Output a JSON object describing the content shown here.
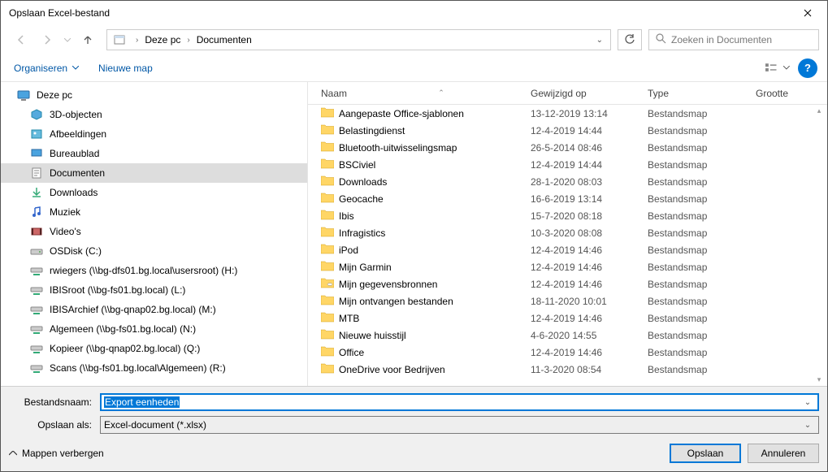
{
  "window": {
    "title": "Opslaan Excel-bestand"
  },
  "breadcrumb": {
    "root": "Deze pc",
    "folder": "Documenten"
  },
  "search": {
    "placeholder": "Zoeken in Documenten"
  },
  "toolbar": {
    "organize": "Organiseren",
    "newfolder": "Nieuwe map"
  },
  "columns": {
    "name": "Naam",
    "modified": "Gewijzigd op",
    "type": "Type",
    "size": "Grootte"
  },
  "tree": {
    "root": "Deze pc",
    "items": [
      {
        "label": "3D-objecten"
      },
      {
        "label": "Afbeeldingen"
      },
      {
        "label": "Bureaublad"
      },
      {
        "label": "Documenten",
        "selected": true
      },
      {
        "label": "Downloads"
      },
      {
        "label": "Muziek"
      },
      {
        "label": "Video's"
      },
      {
        "label": "OSDisk (C:)"
      },
      {
        "label": "rwiegers (\\\\bg-dfs01.bg.local\\usersroot) (H:)"
      },
      {
        "label": "IBISroot (\\\\bg-fs01.bg.local) (L:)"
      },
      {
        "label": "IBISArchief (\\\\bg-qnap02.bg.local) (M:)"
      },
      {
        "label": "Algemeen (\\\\bg-fs01.bg.local) (N:)"
      },
      {
        "label": "Kopieer (\\\\bg-qnap02.bg.local) (Q:)"
      },
      {
        "label": "Scans (\\\\bg-fs01.bg.local\\Algemeen) (R:)"
      }
    ]
  },
  "files": [
    {
      "name": "Aangepaste Office-sjablonen",
      "modified": "13-12-2019 13:14",
      "type": "Bestandsmap"
    },
    {
      "name": "Belastingdienst",
      "modified": "12-4-2019 14:44",
      "type": "Bestandsmap"
    },
    {
      "name": "Bluetooth-uitwisselingsmap",
      "modified": "26-5-2014 08:46",
      "type": "Bestandsmap"
    },
    {
      "name": "BSCiviel",
      "modified": "12-4-2019 14:44",
      "type": "Bestandsmap"
    },
    {
      "name": "Downloads",
      "modified": "28-1-2020 08:03",
      "type": "Bestandsmap"
    },
    {
      "name": "Geocache",
      "modified": "16-6-2019 13:14",
      "type": "Bestandsmap"
    },
    {
      "name": "Ibis",
      "modified": "15-7-2020 08:18",
      "type": "Bestandsmap"
    },
    {
      "name": "Infragistics",
      "modified": "10-3-2020 08:08",
      "type": "Bestandsmap"
    },
    {
      "name": "iPod",
      "modified": "12-4-2019 14:46",
      "type": "Bestandsmap"
    },
    {
      "name": "Mijn Garmin",
      "modified": "12-4-2019 14:46",
      "type": "Bestandsmap"
    },
    {
      "name": "Mijn gegevensbronnen",
      "modified": "12-4-2019 14:46",
      "type": "Bestandsmap"
    },
    {
      "name": "Mijn ontvangen bestanden",
      "modified": "18-11-2020 10:01",
      "type": "Bestandsmap"
    },
    {
      "name": "MTB",
      "modified": "12-4-2019 14:46",
      "type": "Bestandsmap"
    },
    {
      "name": "Nieuwe huisstijl",
      "modified": "4-6-2020 14:55",
      "type": "Bestandsmap"
    },
    {
      "name": "Office",
      "modified": "12-4-2019 14:46",
      "type": "Bestandsmap"
    },
    {
      "name": "OneDrive voor Bedrijven",
      "modified": "11-3-2020 08:54",
      "type": "Bestandsmap"
    }
  ],
  "form": {
    "filename_label": "Bestandsnaam:",
    "filename_value": "Export eenheden",
    "saveas_label": "Opslaan als:",
    "saveas_value": "Excel-document (*.xlsx)"
  },
  "actions": {
    "hidefolders": "Mappen verbergen",
    "save": "Opslaan",
    "cancel": "Annuleren"
  }
}
